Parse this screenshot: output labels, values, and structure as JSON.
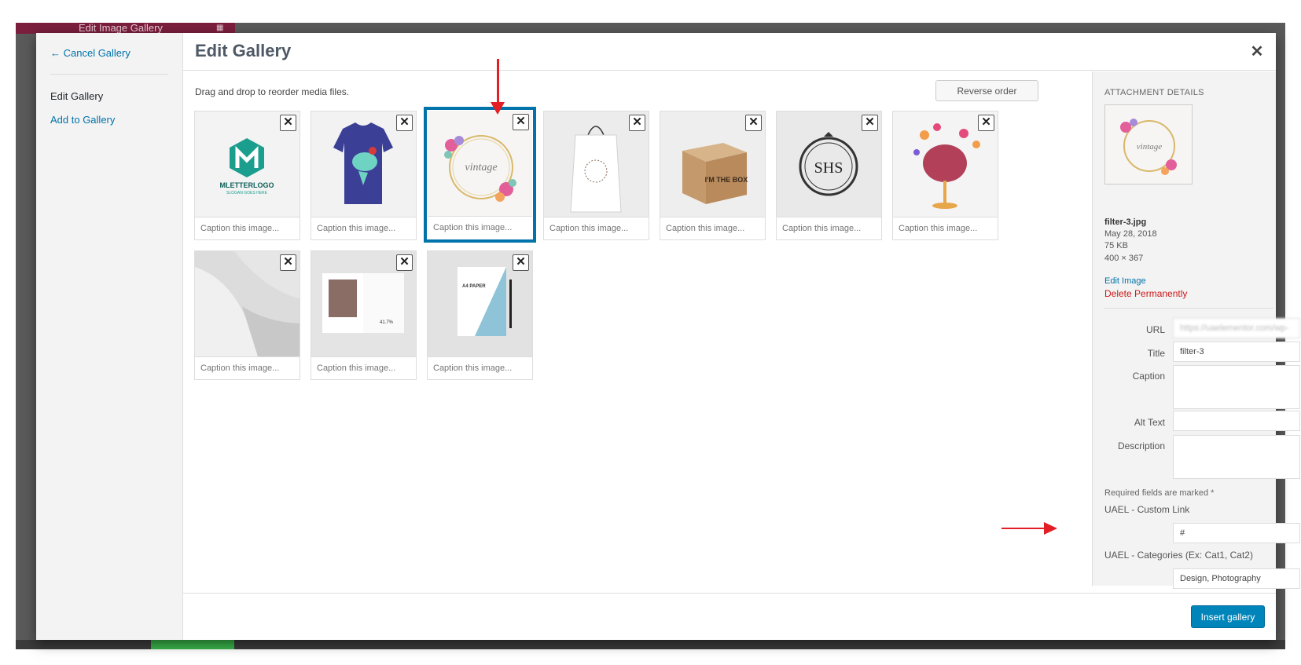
{
  "editor": {
    "title": "Edit Image Gallery"
  },
  "menu": {
    "cancel_label": "← Cancel Gallery",
    "active_label": "Edit Gallery",
    "add_label": "Add to Gallery"
  },
  "header": {
    "title": "Edit Gallery",
    "close_icon": "close-icon"
  },
  "content": {
    "instructions": "Drag and drop to reorder media files.",
    "reverse_label": "Reverse order",
    "remove_symbol": "✕",
    "caption_placeholder": "Caption this image...",
    "items": [
      {
        "name": "mletter-logo",
        "logo_text": "MLETTERLOGO",
        "logo_sub": "SLOGAN GOES HERE"
      },
      {
        "name": "tshirt"
      },
      {
        "name": "vintage-floral",
        "logo_text": "vintage",
        "selected": true
      },
      {
        "name": "shopping-bag"
      },
      {
        "name": "cardboard-box",
        "logo_text": "I'M THE BOX"
      },
      {
        "name": "shs-monogram",
        "logo_text": "SHS"
      },
      {
        "name": "butterfly-glass"
      },
      {
        "name": "architecture"
      },
      {
        "name": "magazine",
        "logo_text": "41.7%"
      },
      {
        "name": "a4-paper",
        "logo_text": "A4 PAPER"
      }
    ]
  },
  "attachment": {
    "heading": "ATTACHMENT DETAILS",
    "filename": "filter-3.jpg",
    "date": "May 28, 2018",
    "size": "75 KB",
    "dimensions": "400 × 367",
    "edit_label": "Edit Image",
    "delete_label": "Delete Permanently",
    "fields": {
      "url_label": "URL",
      "url_value": "https://uaelementor.com/wp-",
      "title_label": "Title",
      "title_value": "filter-3",
      "caption_label": "Caption",
      "alt_label": "Alt Text",
      "description_label": "Description"
    },
    "required_note": "Required fields are marked *",
    "custom_link_label": "UAEL - Custom Link",
    "custom_link_value": "#",
    "categories_label": "UAEL - Categories (Ex: Cat1, Cat2)",
    "categories_value": "Design, Photography"
  },
  "footer": {
    "insert_label": "Insert gallery"
  },
  "colors": {
    "accent": "#0073aa",
    "primary_button": "#0085ba",
    "danger": "#cc1818",
    "annotation": "#e31e24"
  }
}
